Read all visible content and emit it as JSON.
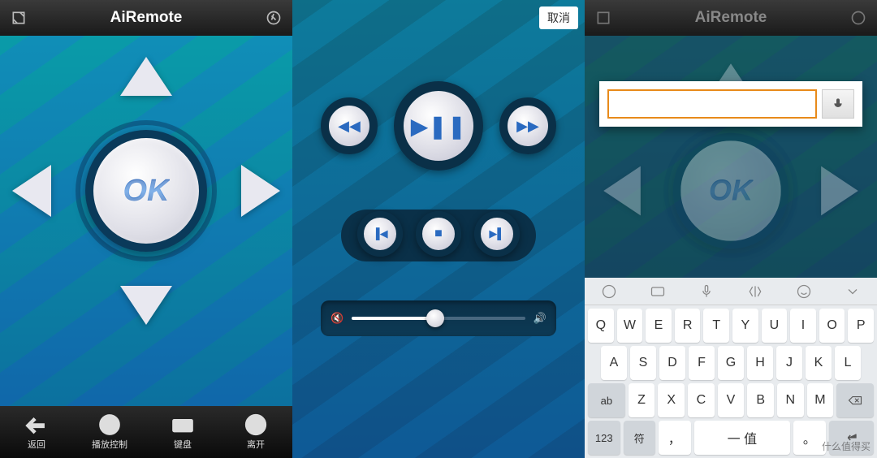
{
  "app": {
    "title": "AiRemote"
  },
  "panel1": {
    "ok_label": "OK",
    "nav": [
      {
        "label": "返回",
        "name": "nav-back"
      },
      {
        "label": "播放控制",
        "name": "nav-play-control"
      },
      {
        "label": "键盘",
        "name": "nav-keyboard"
      },
      {
        "label": "离开",
        "name": "nav-leave"
      }
    ]
  },
  "panel2": {
    "cancel_label": "取消",
    "volume_percent": 48
  },
  "panel3": {
    "ok_label": "OK",
    "search_value": "",
    "keyboard": {
      "row1": [
        "Q",
        "W",
        "E",
        "R",
        "T",
        "Y",
        "U",
        "I",
        "O",
        "P"
      ],
      "row2": [
        "A",
        "S",
        "D",
        "F",
        "G",
        "H",
        "J",
        "K",
        "L"
      ],
      "row3_shift": "ab",
      "row3": [
        "Z",
        "X",
        "C",
        "V",
        "B",
        "N",
        "M"
      ],
      "row4": {
        "num": "123",
        "sym": "符",
        "comma": "，",
        "space": "一    值",
        "period": "。"
      }
    }
  },
  "watermark": "什么值得买"
}
